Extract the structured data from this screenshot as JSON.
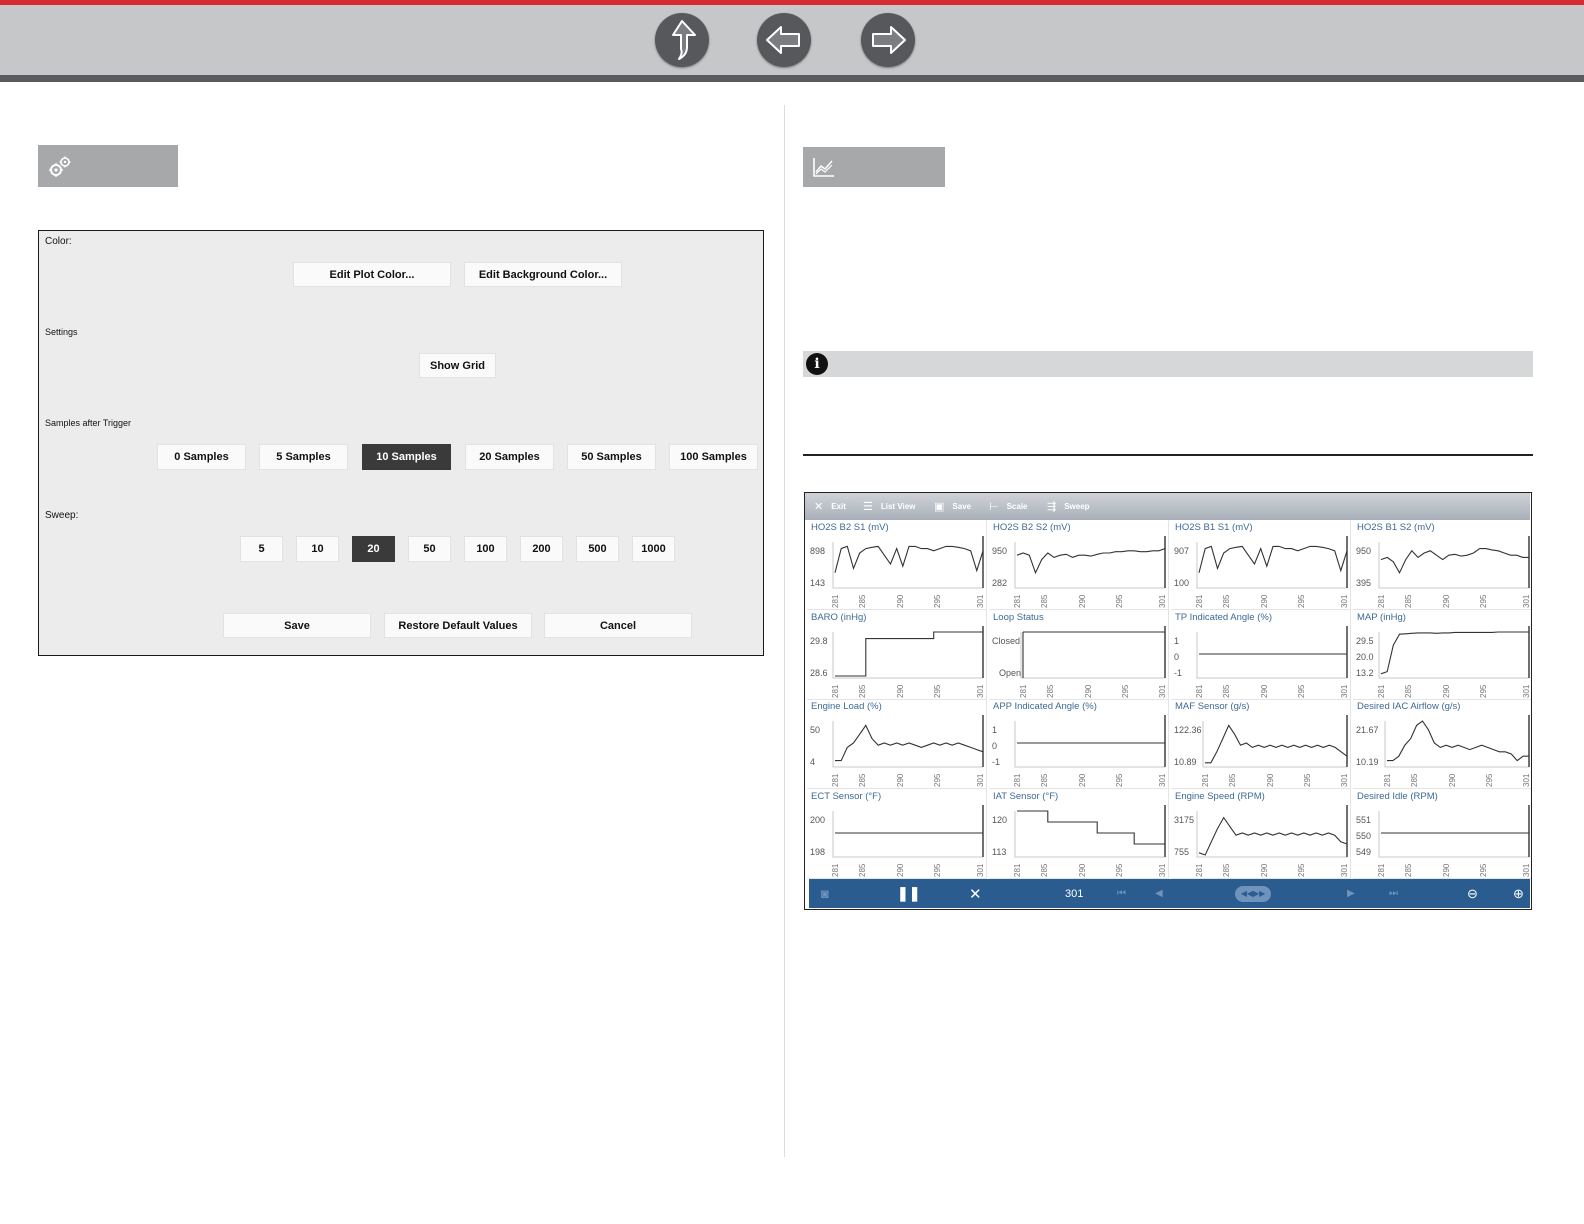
{
  "header": {
    "nav_buttons": [
      {
        "icon": "up-arrow-icon"
      },
      {
        "icon": "back-arrow-icon"
      },
      {
        "icon": "forward-arrow-icon"
      }
    ]
  },
  "left_section": {
    "tab_icon": "gears-icon"
  },
  "settings_dialog": {
    "color_label": "Color:",
    "edit_plot_color": "Edit Plot Color...",
    "edit_background_color": "Edit Background Color...",
    "settings_label": "Settings",
    "show_grid": "Show Grid",
    "samples_label": "Samples after Trigger",
    "samples_options": [
      "0 Samples",
      "5 Samples",
      "10 Samples",
      "20 Samples",
      "50 Samples",
      "100 Samples"
    ],
    "samples_selected": "10 Samples",
    "sweep_label": "Sweep:",
    "sweep_options": [
      "5",
      "10",
      "20",
      "50",
      "100",
      "200",
      "500",
      "1000"
    ],
    "sweep_selected": "20",
    "save": "Save",
    "restore_defaults": "Restore Default Values",
    "cancel": "Cancel"
  },
  "right_section": {
    "tab_icon": "graph-icon",
    "info_icon": "info-icon"
  },
  "graph_screen": {
    "toolbar": {
      "exit": "Exit",
      "list_view": "List View",
      "save": "Save",
      "scale": "Scale",
      "sweep": "Sweep"
    },
    "x_ticks": [
      "281",
      "285",
      "290",
      "295",
      "301"
    ],
    "panels": [
      {
        "title": "HO2S B2 S1 (mV)",
        "ymax": "898",
        "ymin": "143",
        "values": [
          0.3,
          0.85,
          0.9,
          0.4,
          0.75,
          0.85,
          0.88,
          0.9,
          0.7,
          0.5,
          0.85,
          0.45,
          0.9,
          0.9,
          0.85,
          0.85,
          0.8,
          0.85,
          0.9,
          0.9,
          0.88,
          0.85,
          0.8,
          0.35,
          0.8
        ]
      },
      {
        "title": "HO2S B2 S2 (mV)",
        "ymax": "950",
        "ymin": "282",
        "values": [
          0.7,
          0.75,
          0.7,
          0.3,
          0.6,
          0.75,
          0.65,
          0.7,
          0.72,
          0.65,
          0.7,
          0.7,
          0.68,
          0.72,
          0.75,
          0.75,
          0.78,
          0.78,
          0.8,
          0.8,
          0.78,
          0.78,
          0.8,
          0.8,
          0.85
        ]
      },
      {
        "title": "HO2S B1 S1 (mV)",
        "ymax": "907",
        "ymin": "100",
        "values": [
          0.3,
          0.85,
          0.9,
          0.4,
          0.75,
          0.85,
          0.88,
          0.9,
          0.7,
          0.5,
          0.85,
          0.45,
          0.9,
          0.9,
          0.85,
          0.85,
          0.8,
          0.85,
          0.9,
          0.9,
          0.88,
          0.85,
          0.8,
          0.35,
          0.8
        ]
      },
      {
        "title": "HO2S B1 S2 (mV)",
        "ymax": "950",
        "ymin": "395",
        "values": [
          0.6,
          0.65,
          0.55,
          0.3,
          0.6,
          0.8,
          0.65,
          0.75,
          0.8,
          0.7,
          0.6,
          0.7,
          0.72,
          0.68,
          0.7,
          0.75,
          0.85,
          0.85,
          0.82,
          0.8,
          0.75,
          0.7,
          0.7,
          0.65,
          0.65
        ]
      },
      {
        "title": "BARO (inHg)",
        "ymax": "29.8",
        "ymin": "28.6",
        "values": [
          0,
          0,
          0,
          0,
          0,
          0.85,
          0.85,
          0.85,
          0.85,
          0.85,
          0.85,
          0.85,
          0.85,
          0.85,
          0.85,
          0.85,
          1,
          1,
          1,
          1,
          1,
          1,
          1,
          1,
          1
        ],
        "step": true
      },
      {
        "title": "Loop Status",
        "ymax": "Closed",
        "ymin": "Open",
        "values": [
          1,
          1,
          1,
          1,
          1,
          1,
          1,
          1,
          1,
          1,
          1,
          1,
          1,
          1,
          1,
          1,
          1,
          1,
          1,
          1,
          1,
          1,
          1,
          1,
          1
        ],
        "flat": true
      },
      {
        "title": "TP Indicated Angle (%)",
        "ymax": "1",
        "ymid": "0",
        "ymin": "-1",
        "values": [
          0.5,
          0.5,
          0.5,
          0.5,
          0.5,
          0.5,
          0.5,
          0.5,
          0.5,
          0.5,
          0.5,
          0.5,
          0.5,
          0.5,
          0.5,
          0.5,
          0.5,
          0.5,
          0.5,
          0.5,
          0.5,
          0.5,
          0.5,
          0.5,
          0.5
        ]
      },
      {
        "title": "MAP (inHg)",
        "ymax": "29.5",
        "ymid": "20.0",
        "ymin": "13.2",
        "values": [
          0.05,
          0.1,
          0.7,
          0.95,
          0.96,
          0.97,
          0.98,
          0.98,
          0.98,
          0.97,
          0.98,
          0.98,
          0.99,
          0.99,
          0.99,
          0.99,
          0.99,
          0.99,
          0.99,
          1,
          1,
          1,
          1,
          1,
          1
        ]
      },
      {
        "title": "Engine Load (%)",
        "ymax": "50",
        "ymin": "4",
        "values": [
          0.1,
          0.1,
          0.4,
          0.5,
          0.7,
          0.9,
          0.6,
          0.45,
          0.5,
          0.45,
          0.5,
          0.45,
          0.5,
          0.45,
          0.4,
          0.45,
          0.5,
          0.45,
          0.5,
          0.45,
          0.5,
          0.45,
          0.4,
          0.35,
          0.3
        ]
      },
      {
        "title": "APP Indicated Angle (%)",
        "ymax": "1",
        "ymid": "0",
        "ymin": "-1",
        "values": [
          0.5,
          0.5,
          0.5,
          0.5,
          0.5,
          0.5,
          0.5,
          0.5,
          0.5,
          0.5,
          0.5,
          0.5,
          0.5,
          0.5,
          0.5,
          0.5,
          0.5,
          0.5,
          0.5,
          0.5,
          0.5,
          0.5,
          0.5,
          0.5,
          0.5
        ]
      },
      {
        "title": "MAF Sensor (g/s)",
        "ymax": "122.36",
        "ymin": "10.89",
        "values": [
          0.05,
          0.05,
          0.3,
          0.6,
          0.9,
          0.7,
          0.45,
          0.5,
          0.4,
          0.45,
          0.4,
          0.45,
          0.4,
          0.45,
          0.4,
          0.45,
          0.4,
          0.45,
          0.4,
          0.45,
          0.4,
          0.45,
          0.4,
          0.3,
          0.2
        ]
      },
      {
        "title": "Desired IAC Airflow (g/s)",
        "ymax": "21.67",
        "ymin": "10.19",
        "values": [
          0.1,
          0.1,
          0.2,
          0.45,
          0.6,
          0.9,
          1,
          0.8,
          0.5,
          0.4,
          0.45,
          0.4,
          0.45,
          0.4,
          0.35,
          0.4,
          0.45,
          0.4,
          0.35,
          0.3,
          0.3,
          0.25,
          0.1,
          0.2,
          0.2
        ]
      },
      {
        "title": "ECT Sensor (°F)",
        "ymax": "200",
        "ymin": "198",
        "values": [
          0.5,
          0.5,
          0.5,
          0.5,
          0.5,
          0.5,
          0.5,
          0.5,
          0.5,
          0.5,
          0.5,
          0.5,
          0.5,
          0.5,
          0.5,
          0.5,
          0.5,
          0.5,
          0.5,
          0.5,
          0.5,
          0.5,
          0.5,
          0.5,
          0.5
        ]
      },
      {
        "title": "IAT Sensor (°F)",
        "ymax": "120",
        "ymin": "113",
        "values": [
          1,
          1,
          1,
          1,
          1,
          0.75,
          0.75,
          0.75,
          0.75,
          0.75,
          0.75,
          0.75,
          0.75,
          0.5,
          0.5,
          0.5,
          0.5,
          0.5,
          0.5,
          0.25,
          0.25,
          0.25,
          0.25,
          0.25,
          0.25
        ],
        "step": true
      },
      {
        "title": "Engine Speed (RPM)",
        "ymax": "3175",
        "ymin": "755",
        "values": [
          0.05,
          0.0,
          0.3,
          0.6,
          0.85,
          0.65,
          0.45,
          0.5,
          0.45,
          0.5,
          0.45,
          0.5,
          0.45,
          0.5,
          0.45,
          0.5,
          0.45,
          0.5,
          0.45,
          0.5,
          0.45,
          0.5,
          0.45,
          0.3,
          0.25
        ]
      },
      {
        "title": "Desired Idle (RPM)",
        "ymax": "551",
        "ymid": "550",
        "ymin": "549",
        "values": [
          0.5,
          0.5,
          0.5,
          0.5,
          0.5,
          0.5,
          0.5,
          0.5,
          0.5,
          0.5,
          0.5,
          0.5,
          0.5,
          0.5,
          0.5,
          0.5,
          0.5,
          0.5,
          0.5,
          0.5,
          0.5,
          0.5,
          0.5,
          0.5,
          0.5
        ]
      }
    ],
    "playback": {
      "frame_counter": "301"
    }
  }
}
